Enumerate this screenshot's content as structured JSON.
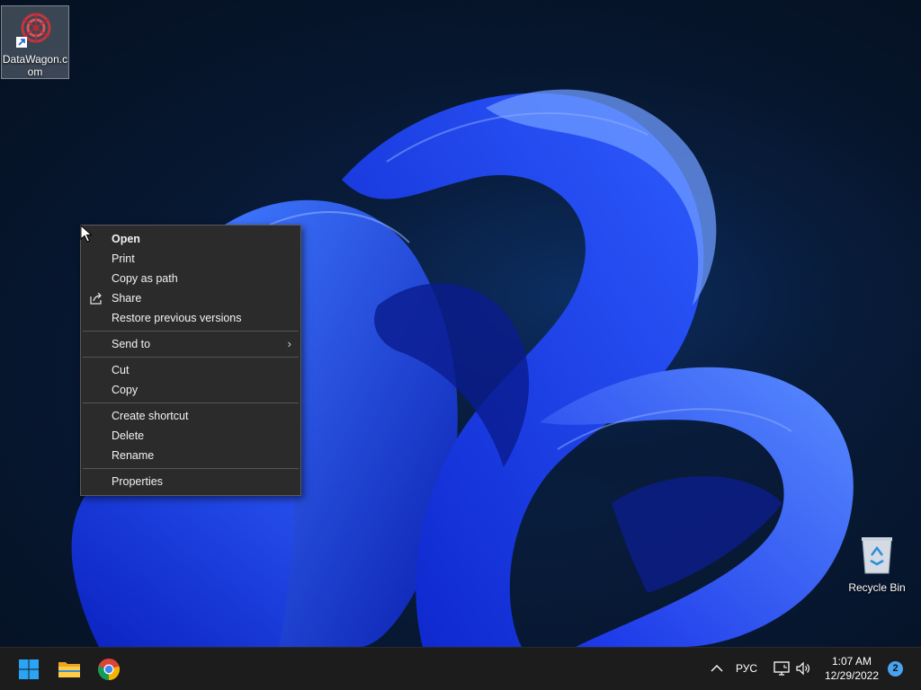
{
  "desktop": {
    "icons": [
      {
        "label": "DataWagon.com",
        "icon": "datawagon-shortcut-icon"
      },
      {
        "label": "Recycle Bin",
        "icon": "recycle-bin-icon"
      }
    ]
  },
  "context_menu": {
    "items": [
      {
        "label": "Open",
        "bold": true
      },
      {
        "label": "Print"
      },
      {
        "label": "Copy as path"
      },
      {
        "label": "Share",
        "icon": "share-icon"
      },
      {
        "label": "Restore previous versions"
      },
      {
        "label": "Send to",
        "submenu": true
      },
      {
        "label": "Cut"
      },
      {
        "label": "Copy"
      },
      {
        "label": "Create shortcut"
      },
      {
        "label": "Delete"
      },
      {
        "label": "Rename"
      },
      {
        "label": "Properties"
      }
    ]
  },
  "taskbar": {
    "pinned": [
      "start-button",
      "file-explorer",
      "chrome"
    ],
    "tray": {
      "language": "РУС",
      "time": "1:07 AM",
      "date": "12/29/2022",
      "notification_count": "2"
    }
  },
  "colors": {
    "accent": "#4aa3f0",
    "menu_bg": "#2b2b2b",
    "taskbar_bg": "#1c1c1c",
    "wallpaper_blue": "#1a3ff0"
  }
}
